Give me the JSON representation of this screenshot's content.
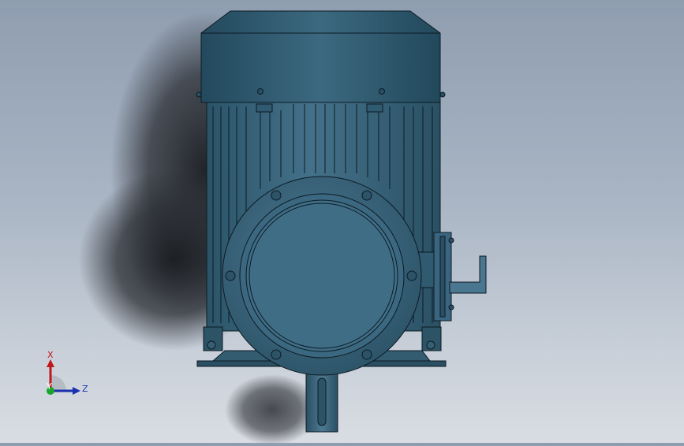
{
  "viewport": {
    "background_top": "#8f9db0",
    "background_bottom": "#d9dde3",
    "model_color": "#3f6b82",
    "model_dark": "#2a4e62",
    "edge_color": "#0d1b24"
  },
  "triad": {
    "x_label": "X",
    "y_label": "Y",
    "z_label": "Z",
    "x_color": "#c0161c",
    "y_color": "#1aa32a",
    "z_color": "#1a2fb0"
  }
}
